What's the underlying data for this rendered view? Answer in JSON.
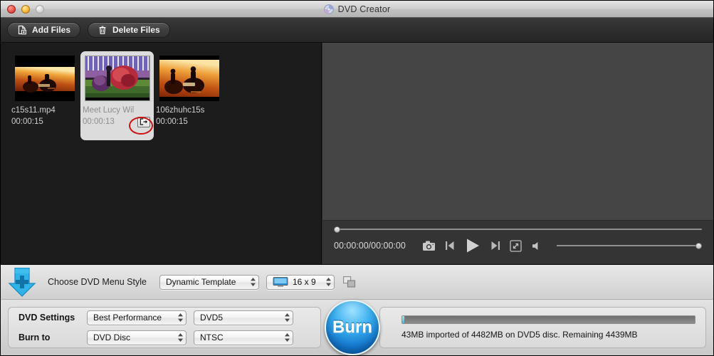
{
  "window": {
    "title": "DVD Creator",
    "title_icon": "dvd-disc-icon",
    "controls": [
      "close-button",
      "minimize-button",
      "zoom-button"
    ]
  },
  "toolbar": {
    "add_files_label": "Add Files",
    "add_files_icon": "document-add-icon",
    "delete_files_label": "Delete Files",
    "delete_files_icon": "trash-icon"
  },
  "files": [
    {
      "name": "c15s11.mp4",
      "duration": "00:00:15",
      "selected": false,
      "thumbnail": "sunset-silhouette-letterboxed"
    },
    {
      "name": "Meet Lucy Wil",
      "duration": "00:00:13",
      "selected": true,
      "thumbnail": "parade-float-flowers",
      "export_icon": "export-arrow-icon"
    },
    {
      "name": "106zhuhc15s",
      "duration": "00:00:15",
      "selected": false,
      "thumbnail": "sunset-camel-riders"
    }
  ],
  "annotation": {
    "shape": "red-ellipse",
    "color": "#cc1111",
    "target": "export-button"
  },
  "player": {
    "timecode": "00:00:00/00:00:00",
    "seek_position_pct": 0,
    "volume_pct": 100,
    "buttons": [
      {
        "name": "snapshot-button",
        "icon": "camera-icon"
      },
      {
        "name": "previous-frame-button",
        "icon": "step-backward-icon"
      },
      {
        "name": "play-button",
        "icon": "play-icon"
      },
      {
        "name": "next-frame-button",
        "icon": "step-forward-icon"
      },
      {
        "name": "fullscreen-button",
        "icon": "expand-icon"
      },
      {
        "name": "volume-button",
        "icon": "speaker-icon"
      }
    ]
  },
  "menu_style_bar": {
    "add_icon": "blue-down-arrow-plus-icon",
    "label": "Choose DVD Menu Style",
    "template": "Dynamic Template",
    "aspect_ratio": "16 x 9",
    "aspect_icon": "monitor-icon",
    "windows_icon": "cascade-windows-icon"
  },
  "settings": {
    "dvd_settings_label": "DVD Settings",
    "quality": "Best Performance",
    "disc_type": "DVD5",
    "burn_to_label": "Burn to",
    "target": "DVD Disc",
    "tv_standard": "NTSC"
  },
  "burn": {
    "label": "Burn"
  },
  "status": {
    "progress_pct": 1,
    "text": "43MB imported of 4482MB on DVD5 disc. Remaining 4439MB"
  },
  "colors": {
    "accent_blue": "#1478cf",
    "progress_cyan": "#22c6e8",
    "annotation_red": "#cc1111",
    "panel_dark": "#1c1c1c",
    "preview_grey": "#454545"
  }
}
